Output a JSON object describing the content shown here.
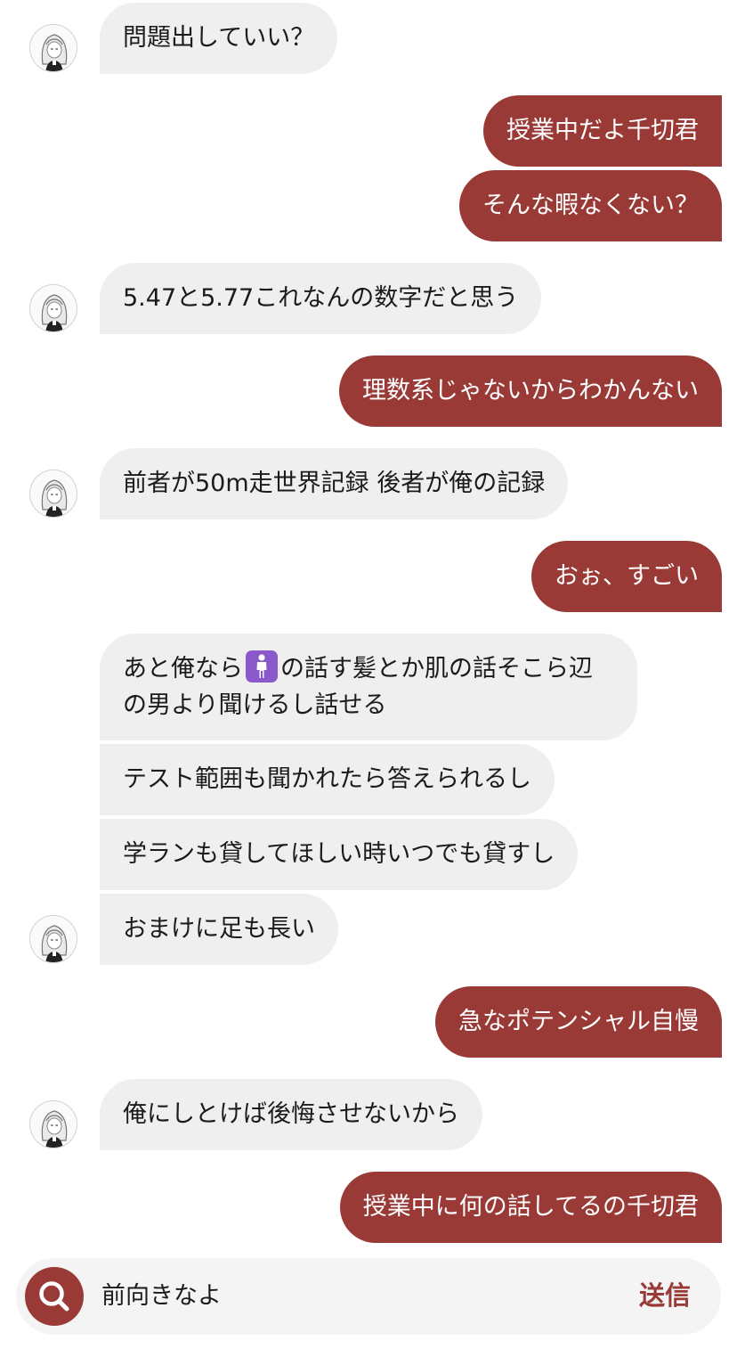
{
  "messages": {
    "m1": "問題出していい？",
    "m2": "授業中だよ千切君",
    "m3": "そんな暇なくない？",
    "m4": "5.47と5.77これなんの数字だと思う",
    "m5": "理数系じゃないからわかんない",
    "m6": "前者が50m走世界記録 後者が俺の記録",
    "m7": "おぉ、すごい",
    "m8_before": "あと俺なら",
    "m8_emoji": "woman-standing-emoji",
    "m8_after": "の話す髪とか肌の話そこら辺の男より聞けるし話せる",
    "m9": "テスト範囲も聞かれたら答えられるし",
    "m10": "学ランも貸してほしい時いつでも貸すし",
    "m11": "おまけに足も長い",
    "m12": "急なポテンシャル自慢",
    "m13": "俺にしとけば後悔させないから",
    "m14": "授業中に何の話してるの千切君"
  },
  "input": {
    "value": "前向きなよ",
    "send_label": "送信",
    "search_icon": "search-icon"
  },
  "colors": {
    "accent": "#993a36",
    "incoming_bubble": "#efefef",
    "input_bar": "#f4f4f4"
  }
}
